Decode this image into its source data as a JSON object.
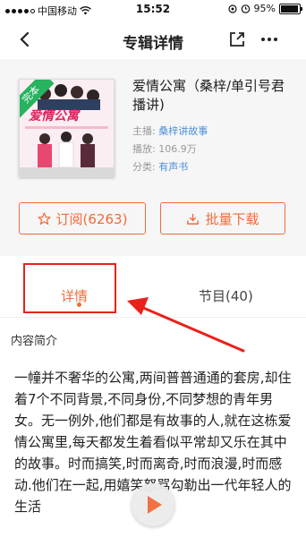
{
  "status_bar": {
    "carrier": "中国移动",
    "time": "15:52",
    "battery": "95%",
    "battery_level": 0.95
  },
  "nav": {
    "title": "专辑详情",
    "icons": [
      "back-icon",
      "share-icon",
      "more-icon"
    ]
  },
  "album": {
    "cover_badge": "完本",
    "cover_title": "爱情公寓",
    "title": "爱情公寓（桑梓/单引号君播讲)",
    "host_label": "主播:",
    "host": "桑梓讲故事",
    "plays_label": "播放:",
    "plays": "106.9万",
    "category_label": "分类:",
    "category": "有声书"
  },
  "actions": {
    "subscribe": "订阅(6263)",
    "batch_download": "批量下载"
  },
  "tabs": {
    "detail": "详情",
    "episodes": "节目(40)"
  },
  "content": {
    "section_title": "内容简介",
    "intro": "一幢并不奢华的公寓,两间普普通通的套房,却住着7个不同背景,不同身份,不同梦想的青年男女。无一例外,他们都是有故事的人,就在这栋爱情公寓里,每天都发生着看似平常却又乐在其中的故事。时而搞笑,时而离奇,时而浪漫,时而感动.他们在一起,用嬉笑怒骂勾勒出一代年轻人的生活"
  },
  "colors": {
    "accent": "#f26b3a",
    "link": "#4a90d9",
    "annotation": "#e8221b",
    "badge": "#27b35f"
  }
}
